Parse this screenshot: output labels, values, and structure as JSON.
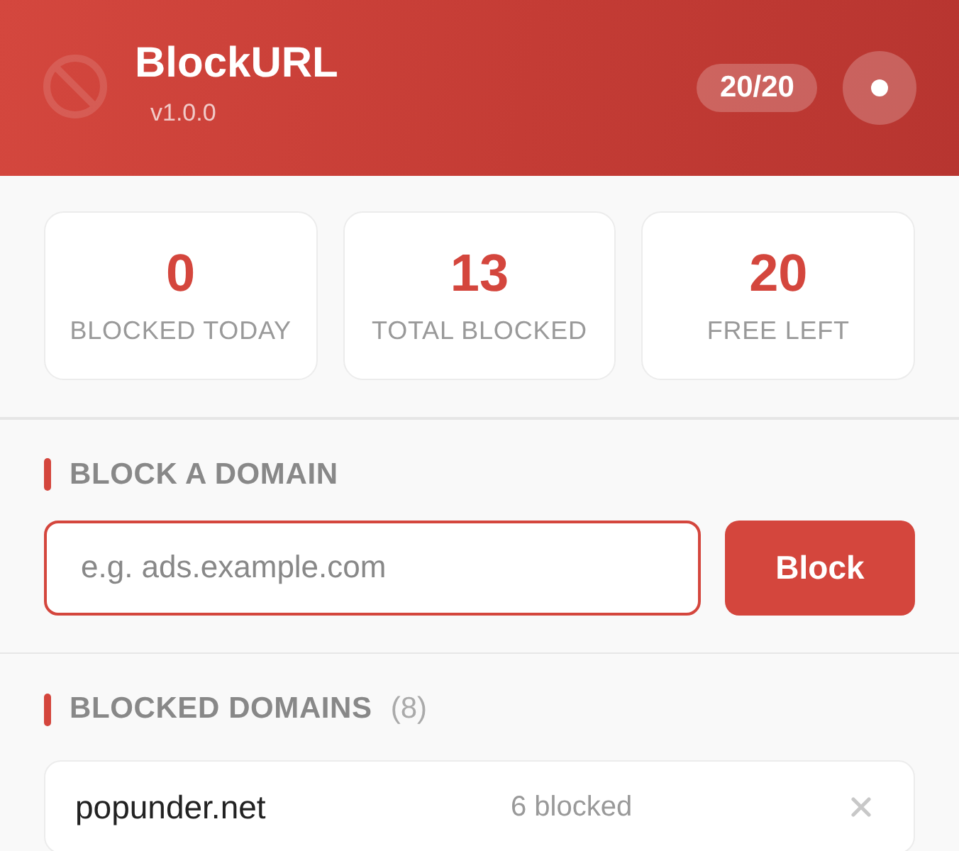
{
  "header": {
    "title": "BlockURL",
    "version": "v1.0.0",
    "quota_badge": "20/20"
  },
  "stats": [
    {
      "value": "0",
      "label": "BLOCKED TODAY"
    },
    {
      "value": "13",
      "label": "TOTAL BLOCKED"
    },
    {
      "value": "20",
      "label": "FREE LEFT"
    }
  ],
  "block_section": {
    "heading": "BLOCK A DOMAIN",
    "input": {
      "placeholder": "e.g. ads.example.com"
    },
    "button": "Block"
  },
  "domains_section": {
    "heading": "BLOCKED DOMAINS",
    "count": "(8)",
    "items": [
      {
        "domain": "popunder.net",
        "blocked_count": "6 blocked"
      }
    ]
  }
}
